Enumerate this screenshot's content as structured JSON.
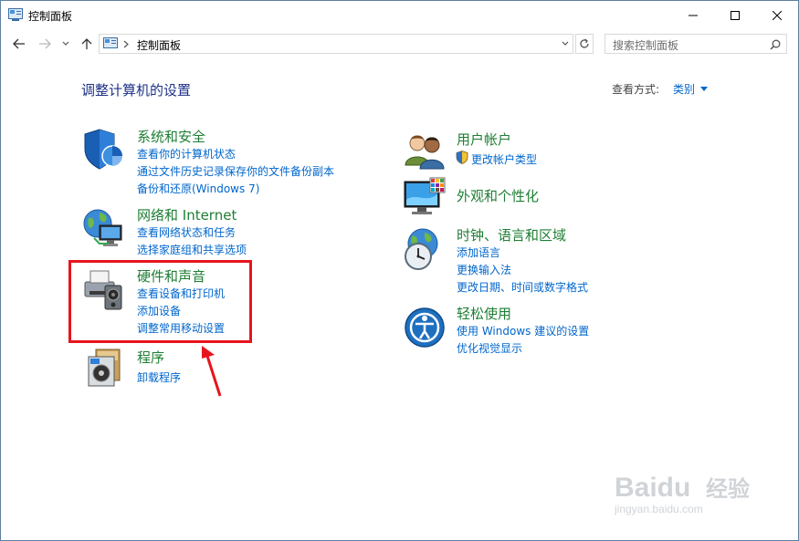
{
  "window": {
    "title": "控制面板"
  },
  "address": {
    "path": "控制面板"
  },
  "search": {
    "placeholder": "搜索控制面板"
  },
  "content": {
    "heading": "调整计算机的设置",
    "view_by_label": "查看方式:",
    "view_by_value": "类别"
  },
  "categories": [
    {
      "title": "系统和安全",
      "icon": "shield-icon",
      "links": [
        "查看你的计算机状态",
        "通过文件历史记录保存你的文件备份副本",
        "备份和还原(Windows 7)"
      ]
    },
    {
      "title": "网络和 Internet",
      "icon": "network-globe-icon",
      "links": [
        "查看网络状态和任务",
        "选择家庭组和共享选项"
      ]
    },
    {
      "title": "硬件和声音",
      "icon": "printer-speaker-icon",
      "links": [
        "查看设备和打印机",
        "添加设备",
        "调整常用移动设置"
      ]
    },
    {
      "title": "程序",
      "icon": "programs-icon",
      "links": [
        "卸载程序"
      ]
    },
    {
      "title": "用户帐户",
      "icon": "users-icon",
      "links": [
        "更改帐户类型"
      ]
    },
    {
      "title": "外观和个性化",
      "icon": "monitor-palette-icon",
      "links": []
    },
    {
      "title": "时钟、语言和区域",
      "icon": "clock-globe-icon",
      "links": [
        "添加语言",
        "更换输入法",
        "更改日期、时间或数字格式"
      ]
    },
    {
      "title": "轻松使用",
      "icon": "ease-of-access-icon",
      "links": [
        "使用 Windows 建议的设置",
        "优化视觉显示"
      ]
    }
  ],
  "watermark": {
    "brand": "Baidu",
    "cn": "经验",
    "url": "jingyan.baidu.com"
  },
  "colors": {
    "category_title": "#1e7e34",
    "link": "#0066cc",
    "heading": "#1e3287",
    "highlight": "#e8141d"
  }
}
